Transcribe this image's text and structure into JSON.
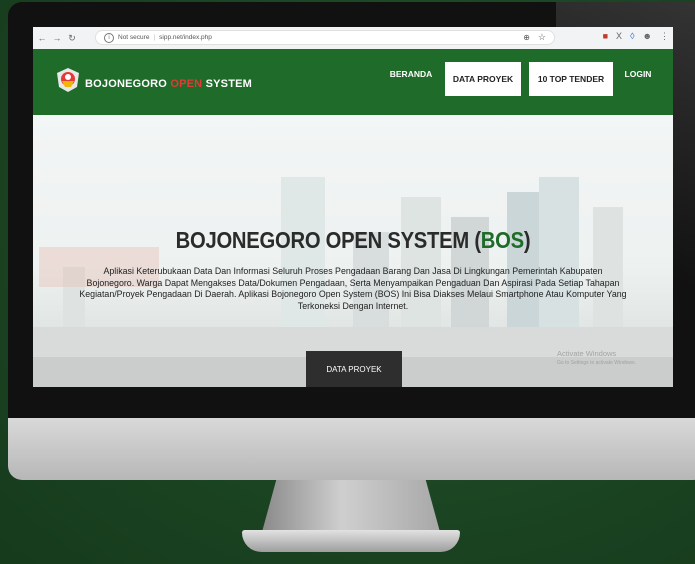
{
  "browser": {
    "security": "Not secure",
    "url": "sipp.net/index.php"
  },
  "header": {
    "brand_part1": "BOJONEGORO",
    "brand_part2": "OPEN",
    "brand_part3": "SYSTEM",
    "nav": {
      "beranda": "BERANDA",
      "data_proyek": "DATA PROYEK",
      "top_tender": "10 TOP TENDER",
      "login": "LOGIN"
    }
  },
  "hero": {
    "title_main": "BOJONEGORO OPEN SYSTEM (",
    "title_accent": "BOS",
    "title_end": ")",
    "description": "Aplikasi Keterubukaan Data Dan Informasi Seluruh Proses Pengadaan Barang Dan Jasa Di Lingkungan Pemerintah Kabupaten Bojonegoro. Warga Dapat Mengakses Data/Dokumen Pengadaan, Serta Menyampaikan Pengaduan Dan Aspirasi Pada Setiap Tahapan Kegiatan/Proyek Pengadaan Di Daerah. Aplikasi Bojonegoro Open System (BOS) Ini Bisa Diakses Melaui Smartphone Atau Komputer Yang Terkoneksi Dengan Internet.",
    "cta": "DATA PROYEK"
  },
  "watermark": {
    "title": "Activate Windows",
    "subtitle": "Go to Settings to activate Windows."
  },
  "colors": {
    "brand_green": "#1f6b2a",
    "accent_red": "#e53935",
    "background": "#1d4a24"
  }
}
